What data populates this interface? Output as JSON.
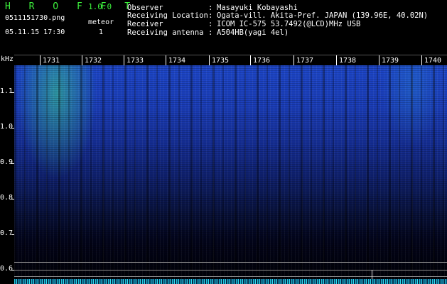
{
  "header": {
    "title": "H R O F F T",
    "version": "1.0.0",
    "filename": "0511151730.png",
    "meteor_label": "meteor",
    "datetime": "05.11.15 17:30",
    "meteor_count": "1"
  },
  "info": [
    {
      "key": "Observer",
      "value": "Masayuki Kobayashi"
    },
    {
      "key": "Receiving Location",
      "value": "Ogata-vill. Akita-Pref. JAPAN (139.96E, 40.02N)"
    },
    {
      "key": "Receiver",
      "value": "ICOM IC-575 53.7492(@LCD)MHz USB"
    },
    {
      "key": "Receiving antenna",
      "value": "A504HB(yagi 4el)"
    }
  ],
  "axis": {
    "unit": "kHz",
    "y_labels": [
      "1.1",
      "1.0",
      "0.9",
      "0.8",
      "0.7",
      "0.6"
    ],
    "x_labels": [
      "1731",
      "1732",
      "1733",
      "1734",
      "1735",
      "1736",
      "1737",
      "1738",
      "1739",
      "1740"
    ]
  },
  "colors": {
    "green": "#3cf03c",
    "signal": "#1d46c8"
  }
}
